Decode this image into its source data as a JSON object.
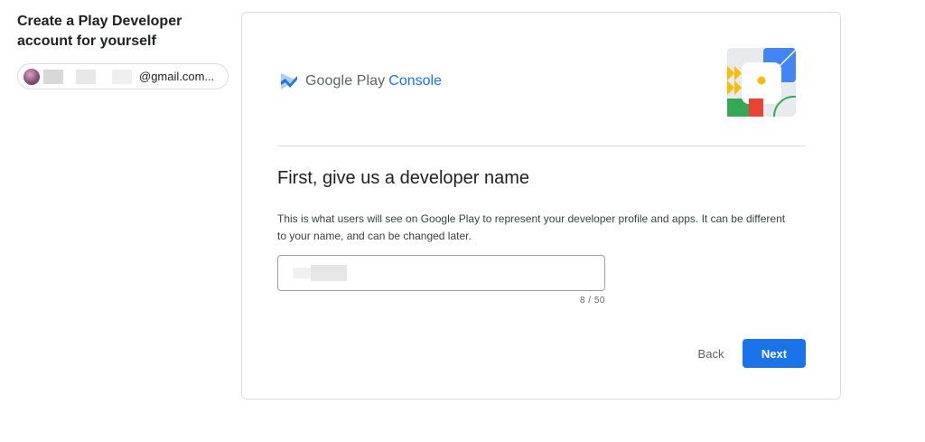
{
  "sidebar": {
    "title": "Create a Play Developer account for yourself",
    "account": {
      "email": "@gmail.com...",
      "avatar_icon": "user-avatar"
    }
  },
  "card": {
    "brand": {
      "name": "Google Play",
      "product": "Console",
      "logo_icon": "play-console-logo-icon",
      "accent_color": "#1a73e8"
    },
    "illustration_icon": "developer-illustration-icon",
    "heading": "First, give us a developer name",
    "description": "This is what users will see on Google Play to represent your developer profile and apps. It can be different to your name, and can be changed later.",
    "developer_name_field": {
      "value": "",
      "counter": "8 / 50"
    },
    "actions": {
      "back_label": "Back",
      "next_label": "Next"
    }
  }
}
